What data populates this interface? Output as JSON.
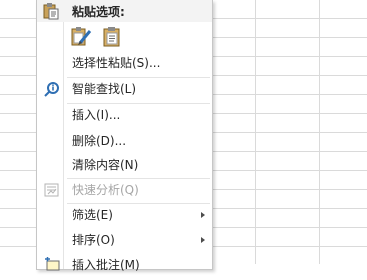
{
  "context_menu": {
    "paste_header": "粘贴选项:",
    "paste_options": [
      {
        "icon": "paste-formatting-icon"
      },
      {
        "icon": "paste-clipboard-icon"
      }
    ],
    "items": [
      {
        "label": "选择性粘贴(S)...",
        "disabled": false,
        "submenu": false
      },
      {
        "label": "智能查找(L)",
        "disabled": false,
        "submenu": false,
        "icon": "smart-lookup-icon"
      },
      {
        "label": "插入(I)...",
        "disabled": false,
        "submenu": false
      },
      {
        "label": "删除(D)...",
        "disabled": false,
        "submenu": false
      },
      {
        "label": "清除内容(N)",
        "disabled": false,
        "submenu": false
      },
      {
        "label": "快速分析(Q)",
        "disabled": true,
        "submenu": false,
        "icon": "quick-analysis-icon"
      },
      {
        "label": "筛选(E)",
        "disabled": false,
        "submenu": true
      },
      {
        "label": "排序(O)",
        "disabled": false,
        "submenu": true
      },
      {
        "label": "插入批注(M)",
        "disabled": false,
        "submenu": false,
        "icon": "insert-comment-icon"
      }
    ]
  }
}
